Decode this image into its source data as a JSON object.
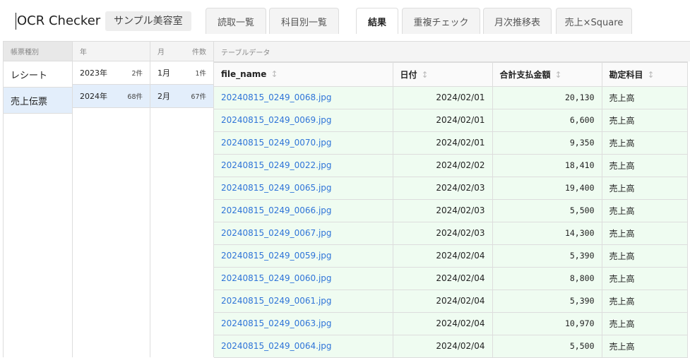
{
  "app_title": "OCR Checker",
  "shop_name": "サンプル美容室",
  "tabs": [
    {
      "label": "読取一覧"
    },
    {
      "label": "科目別一覧"
    },
    {
      "label": "結果",
      "active": true
    },
    {
      "label": "重複チェック"
    },
    {
      "label": "月次推移表"
    },
    {
      "label": "売上×Square"
    }
  ],
  "sidebar": {
    "header": "帳票種別",
    "items": [
      {
        "label": "レシート"
      },
      {
        "label": "売上伝票",
        "selected": true
      }
    ]
  },
  "years": {
    "header": "年",
    "items": [
      {
        "label": "2023年",
        "count": "2件"
      },
      {
        "label": "2024年",
        "count": "68件",
        "selected": true
      }
    ]
  },
  "months": {
    "header": "月",
    "count_header": "件数",
    "items": [
      {
        "label": "1月",
        "count": "1件"
      },
      {
        "label": "2月",
        "count": "67件",
        "selected": true
      }
    ]
  },
  "table": {
    "title": "テーブルデータ",
    "columns": [
      "file_name",
      "日付",
      "合計支払金額",
      "勘定科目"
    ],
    "rows": [
      [
        "20240815_0249_0068.jpg",
        "2024/02/01",
        "20,130",
        "売上高"
      ],
      [
        "20240815_0249_0069.jpg",
        "2024/02/01",
        "6,600",
        "売上高"
      ],
      [
        "20240815_0249_0070.jpg",
        "2024/02/01",
        "9,350",
        "売上高"
      ],
      [
        "20240815_0249_0022.jpg",
        "2024/02/02",
        "18,410",
        "売上高"
      ],
      [
        "20240815_0249_0065.jpg",
        "2024/02/03",
        "19,400",
        "売上高"
      ],
      [
        "20240815_0249_0066.jpg",
        "2024/02/03",
        "5,500",
        "売上高"
      ],
      [
        "20240815_0249_0067.jpg",
        "2024/02/03",
        "14,300",
        "売上高"
      ],
      [
        "20240815_0249_0059.jpg",
        "2024/02/04",
        "5,390",
        "売上高"
      ],
      [
        "20240815_0249_0060.jpg",
        "2024/02/04",
        "8,800",
        "売上高"
      ],
      [
        "20240815_0249_0061.jpg",
        "2024/02/04",
        "5,390",
        "売上高"
      ],
      [
        "20240815_0249_0063.jpg",
        "2024/02/04",
        "10,970",
        "売上高"
      ],
      [
        "20240815_0249_0064.jpg",
        "2024/02/04",
        "5,500",
        "売上高"
      ]
    ]
  }
}
